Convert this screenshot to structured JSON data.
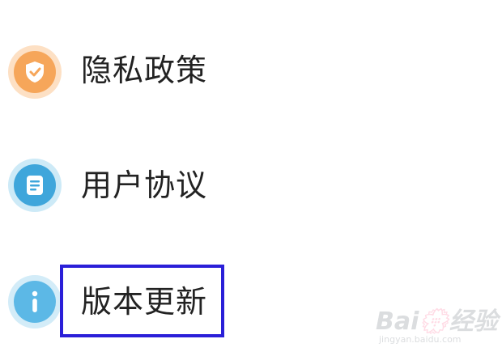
{
  "menu": {
    "items": [
      {
        "label": "隐私政策",
        "icon": "shield-check-icon",
        "color": "#f6a65a",
        "ring": "#fde0c4"
      },
      {
        "label": "用户协议",
        "icon": "document-icon",
        "color": "#3fa6db",
        "ring": "#cdeaf7"
      },
      {
        "label": "版本更新",
        "icon": "info-icon",
        "color": "#5cb8e6",
        "ring": "#d3ecf8"
      }
    ]
  },
  "highlight": {
    "color": "#2a1fd8",
    "target": "版本更新"
  },
  "watermark": {
    "main": "Bai💮经验",
    "sub": "jingyan.baidu.com"
  }
}
